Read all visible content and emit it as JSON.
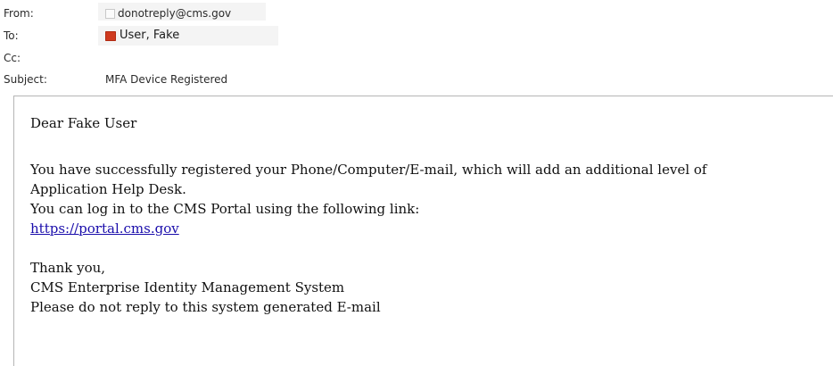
{
  "header": {
    "from_label": "From:",
    "from_value": "donotreply@cms.gov",
    "to_label": "To:",
    "to_value": "User, Fake",
    "cc_label": "Cc:",
    "cc_value": "",
    "subject_label": "Subject:",
    "subject_value": "MFA Device Registered"
  },
  "body": {
    "greeting": "Dear  Fake User",
    "line1": "You have successfully registered your Phone/Computer/E-mail, which will add an additional level of",
    "line2": "Application Help Desk.",
    "line3": "You can log in to the CMS Portal using the following link:",
    "link": "https://portal.cms.gov",
    "thanks": "Thank you,",
    "sig1": "CMS Enterprise Identity Management System",
    "sig2": "Please do not reply to this system generated E-mail"
  },
  "colors": {
    "link": "#1a0dab",
    "contact_icon": "#cf3a1f"
  }
}
